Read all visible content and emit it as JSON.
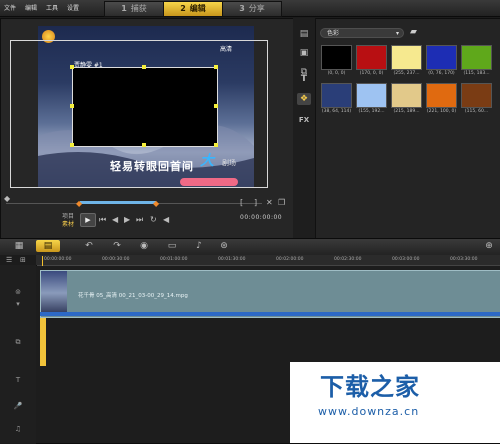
{
  "menu": [
    "文件",
    "编辑",
    "工具",
    "设置"
  ],
  "steps": [
    {
      "num": "1",
      "label": "捕获",
      "active": false
    },
    {
      "num": "2",
      "label": "编辑",
      "active": true
    },
    {
      "num": "3",
      "label": "分享",
      "active": false
    }
  ],
  "preview": {
    "channel_label": "贾静雯 #1",
    "quality_label": "高清",
    "subtitle": "轻易转眼回首间",
    "brand": "大",
    "brand_sub": "剧场",
    "project_label": "项目",
    "clip_label": "素材",
    "timecode": "00:00:00:00"
  },
  "library": {
    "category": "色彩",
    "swatches": [
      {
        "color": "#000000",
        "label": "(0, 0, 0)"
      },
      {
        "color": "#b80f12",
        "label": "(170, 0, 0)"
      },
      {
        "color": "#f6e98f",
        "label": "(255, 237..."
      },
      {
        "color": "#1d2db4",
        "label": "(0, 76, 170)"
      },
      {
        "color": "#5fa81b",
        "label": "(115, 183..."
      },
      {
        "color": "#2a3e78",
        "label": "(38, 64, 114)"
      },
      {
        "color": "#9ec3f2",
        "label": "(155, 192..."
      },
      {
        "color": "#e2c98a",
        "label": "(215, 189..."
      },
      {
        "color": "#e06a10",
        "label": "(221, 100, 0)"
      },
      {
        "color": "#7a3c14",
        "label": "(115, 60..."
      }
    ]
  },
  "timeline": {
    "ruler_ticks": [
      "00:00:00:00",
      "00:00:30:00",
      "00:01:00:00",
      "00:01:30:00",
      "00:02:00:00",
      "00:02:30:00",
      "00:03:00:00",
      "00:03:30:00"
    ],
    "clip_name": "花千骨 05_高清 00_21_03-00_29_14.mpg"
  },
  "watermark": {
    "title": "下载之家",
    "url": "www.downza.cn"
  }
}
